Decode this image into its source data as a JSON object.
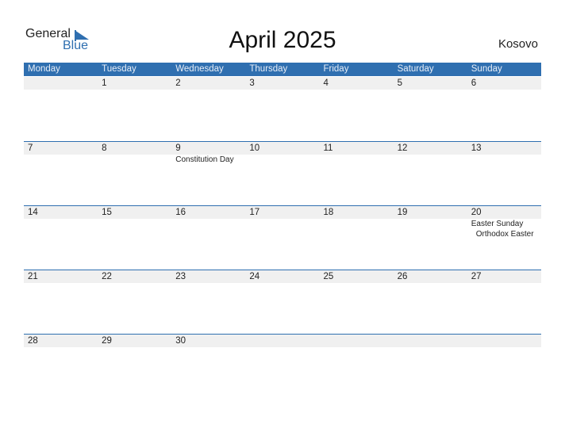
{
  "logo": {
    "general": "General",
    "blue": "Blue",
    "icon": "logo-triangle-icon"
  },
  "title": "April 2025",
  "country": "Kosovo",
  "colors": {
    "accent": "#2f6fb0",
    "date_strip": "#f0f0f0"
  },
  "weekdays": [
    "Monday",
    "Tuesday",
    "Wednesday",
    "Thursday",
    "Friday",
    "Saturday",
    "Sunday"
  ],
  "weeks": [
    {
      "days": [
        {
          "date": "",
          "events": []
        },
        {
          "date": "1",
          "events": []
        },
        {
          "date": "2",
          "events": []
        },
        {
          "date": "3",
          "events": []
        },
        {
          "date": "4",
          "events": []
        },
        {
          "date": "5",
          "events": []
        },
        {
          "date": "6",
          "events": []
        }
      ]
    },
    {
      "days": [
        {
          "date": "7",
          "events": []
        },
        {
          "date": "8",
          "events": []
        },
        {
          "date": "9",
          "events": [
            "Constitution Day"
          ]
        },
        {
          "date": "10",
          "events": []
        },
        {
          "date": "11",
          "events": []
        },
        {
          "date": "12",
          "events": []
        },
        {
          "date": "13",
          "events": []
        }
      ]
    },
    {
      "days": [
        {
          "date": "14",
          "events": []
        },
        {
          "date": "15",
          "events": []
        },
        {
          "date": "16",
          "events": []
        },
        {
          "date": "17",
          "events": []
        },
        {
          "date": "18",
          "events": []
        },
        {
          "date": "19",
          "events": []
        },
        {
          "date": "20",
          "events": [
            "Easter Sunday",
            "Orthodox Easter"
          ]
        }
      ]
    },
    {
      "days": [
        {
          "date": "21",
          "events": []
        },
        {
          "date": "22",
          "events": []
        },
        {
          "date": "23",
          "events": []
        },
        {
          "date": "24",
          "events": []
        },
        {
          "date": "25",
          "events": []
        },
        {
          "date": "26",
          "events": []
        },
        {
          "date": "27",
          "events": []
        }
      ]
    },
    {
      "days": [
        {
          "date": "28",
          "events": []
        },
        {
          "date": "29",
          "events": []
        },
        {
          "date": "30",
          "events": []
        },
        {
          "date": "",
          "events": []
        },
        {
          "date": "",
          "events": []
        },
        {
          "date": "",
          "events": []
        },
        {
          "date": "",
          "events": []
        }
      ]
    }
  ]
}
